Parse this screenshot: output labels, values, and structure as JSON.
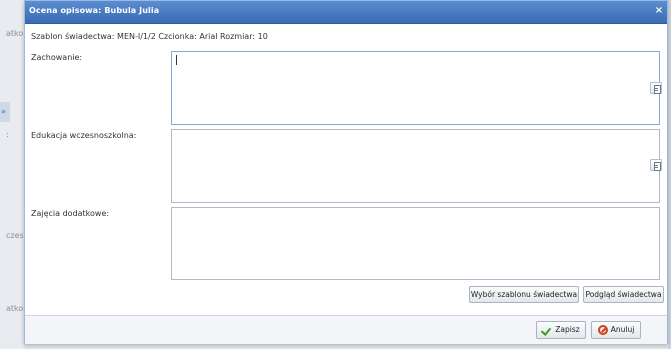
{
  "background": {
    "fragments": [
      "atko",
      ":",
      "czes",
      "atko"
    ],
    "tab_label": "»"
  },
  "dialog": {
    "title": "Ocena opisowa: Bubula Julia",
    "close_glyph": "×",
    "header": "Szablon świadectwa: MEN-I/1/2 Czcionka: Arial Rozmiar: 10",
    "fields": [
      {
        "label": "Zachowanie:",
        "value": ""
      },
      {
        "label": "Edukacja wczesnoszkolna:",
        "value": ""
      },
      {
        "label": "Zajęcia dodatkowe:",
        "value": ""
      }
    ],
    "buttons": {
      "choose_template": "Wybór szablonu świadectwa",
      "preview": "Podgląd świadectwa",
      "save": "Zapisz",
      "cancel": "Anuluj"
    }
  },
  "icons": {
    "document": "document-icon",
    "save": "checkmark-icon",
    "cancel": "cancel-circle-icon",
    "close": "close-icon"
  },
  "colors": {
    "titlebar": "#3a6bb3",
    "border": "#99bbe8",
    "save_icon": "#3d9a2c",
    "cancel_icon": "#d0421b"
  }
}
